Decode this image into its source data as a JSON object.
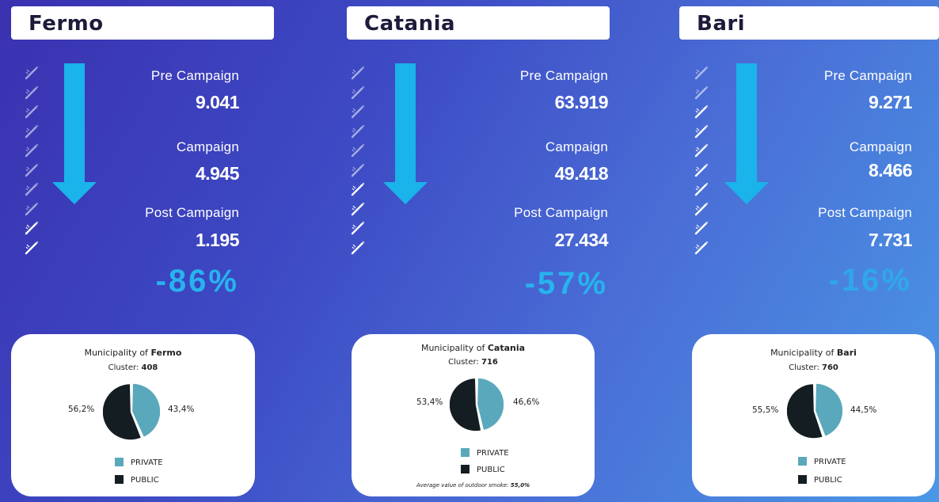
{
  "colors": {
    "arrow": "#1ab3ea",
    "percent": "#27b3ee",
    "private": "#5aa8bb",
    "public": "#141d22"
  },
  "cities": [
    {
      "name": "Fermo",
      "pre_label": "Pre Campaign",
      "pre_value": "9.041",
      "campaign_label": "Campaign",
      "campaign_value": "4.945",
      "post_label": "Post Campaign",
      "post_value": "1.195",
      "change": "-86%",
      "full_icons": 2,
      "card": {
        "title_prefix": "Municipality of ",
        "title_city": "Fermo",
        "cluster_label": "Cluster: ",
        "cluster_value": "408",
        "left_pct": "56,2%",
        "right_pct": "43,4%",
        "legend_private": "PRIVATE",
        "legend_public": "PUBLIC",
        "note_label": "",
        "note_value": ""
      }
    },
    {
      "name": "Catania",
      "pre_label": "Pre Campaign",
      "pre_value": "63.919",
      "campaign_label": "Campaign",
      "campaign_value": "49.418",
      "post_label": "Post Campaign",
      "post_value": "27.434",
      "change": "-57%",
      "full_icons": 4,
      "card": {
        "title_prefix": "Municipality of ",
        "title_city": "Catania",
        "cluster_label": "Cluster: ",
        "cluster_value": "716",
        "left_pct": "53,4%",
        "right_pct": "46,6%",
        "legend_private": "PRIVATE",
        "legend_public": "PUBLIC",
        "note_label": "Average value of outdoor smoke: ",
        "note_value": "55,0%"
      }
    },
    {
      "name": "Bari",
      "pre_label": "Pre Campaign",
      "pre_value": "9.271",
      "campaign_label": "Campaign",
      "campaign_value": "8.466",
      "post_label": "Post Campaign",
      "post_value": "7.731",
      "change": "-16%",
      "full_icons": 8,
      "card": {
        "title_prefix": "Municipality of ",
        "title_city": "Bari",
        "cluster_label": "Cluster: ",
        "cluster_value": "760",
        "left_pct": "55,5%",
        "right_pct": "44,5%",
        "legend_private": "PRIVATE",
        "legend_public": "PUBLIC",
        "note_label": "",
        "note_value": ""
      }
    }
  ],
  "chart_data": [
    {
      "type": "pie",
      "title": "Municipality of Fermo",
      "subtitle": "Cluster: 408",
      "categories": [
        "PRIVATE",
        "PUBLIC"
      ],
      "values": [
        43.4,
        56.2
      ],
      "legend": "bottom"
    },
    {
      "type": "pie",
      "title": "Municipality of Catania",
      "subtitle": "Cluster: 716",
      "categories": [
        "PRIVATE",
        "PUBLIC"
      ],
      "values": [
        46.6,
        53.4
      ],
      "legend": "bottom",
      "annotation": "Average value of outdoor smoke: 55,0%"
    },
    {
      "type": "pie",
      "title": "Municipality of Bari",
      "subtitle": "Cluster: 760",
      "categories": [
        "PRIVATE",
        "PUBLIC"
      ],
      "values": [
        44.5,
        55.5
      ],
      "legend": "bottom"
    },
    {
      "type": "bar",
      "title": "",
      "categories": [
        "Pre Campaign",
        "Campaign",
        "Post Campaign"
      ],
      "series": [
        {
          "name": "Fermo",
          "values": [
            9041,
            4945,
            1195
          ]
        },
        {
          "name": "Catania",
          "values": [
            63919,
            49418,
            27434
          ]
        },
        {
          "name": "Bari",
          "values": [
            9271,
            8466,
            7731
          ]
        }
      ]
    }
  ]
}
